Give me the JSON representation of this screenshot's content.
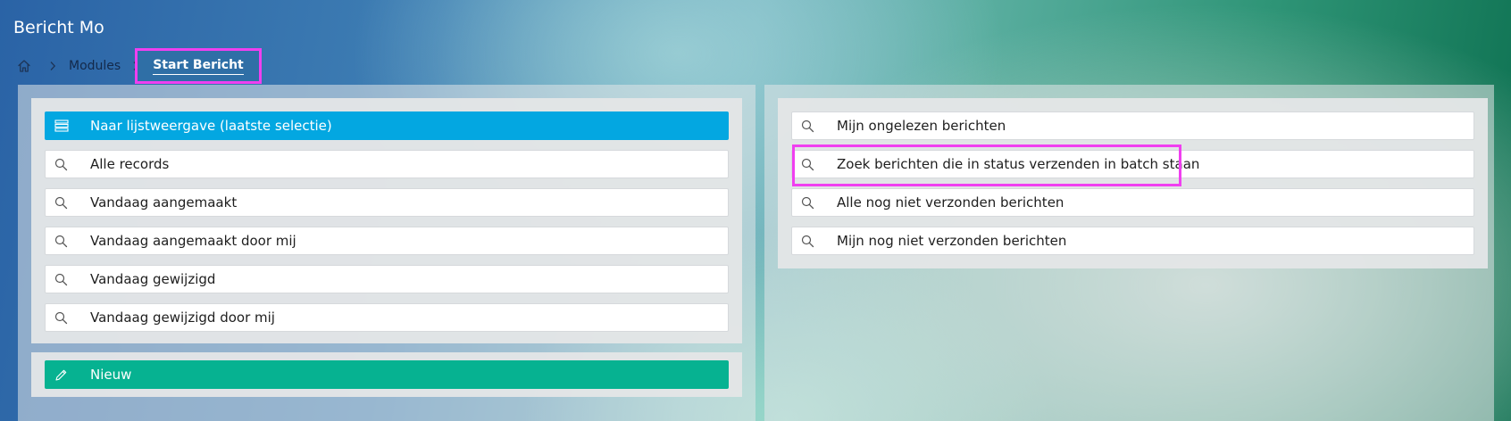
{
  "header": {
    "title": "Bericht Mo"
  },
  "breadcrumb": {
    "home_icon": "home-icon",
    "items": [
      {
        "label": "Modules"
      },
      {
        "label": "Start Bericht"
      }
    ]
  },
  "left_panel": {
    "primary_action": {
      "label": "Naar lijstweergave (laatste selectie)",
      "icon": "list-icon",
      "color": "#03a7e1"
    },
    "searches": [
      {
        "label": "Alle records",
        "icon": "search-icon"
      },
      {
        "label": "Vandaag aangemaakt",
        "icon": "search-icon"
      },
      {
        "label": "Vandaag aangemaakt door mij",
        "icon": "search-icon"
      },
      {
        "label": "Vandaag gewijzigd",
        "icon": "search-icon"
      },
      {
        "label": "Vandaag gewijzigd door mij",
        "icon": "search-icon"
      }
    ],
    "new_action": {
      "label": "Nieuw",
      "icon": "pencil-icon",
      "color": "#06b291"
    }
  },
  "right_panel": {
    "searches": [
      {
        "label": "Mijn ongelezen berichten",
        "icon": "search-icon"
      },
      {
        "label": "Zoek berichten die in status verzenden in batch staan",
        "icon": "search-icon"
      },
      {
        "label": "Alle nog niet verzonden berichten",
        "icon": "search-icon"
      },
      {
        "label": "Mijn nog niet verzonden berichten",
        "icon": "search-icon"
      }
    ]
  },
  "colors": {
    "highlight": "#f03ff0",
    "breadcrumb_active_bg": "#2f6fa6"
  }
}
